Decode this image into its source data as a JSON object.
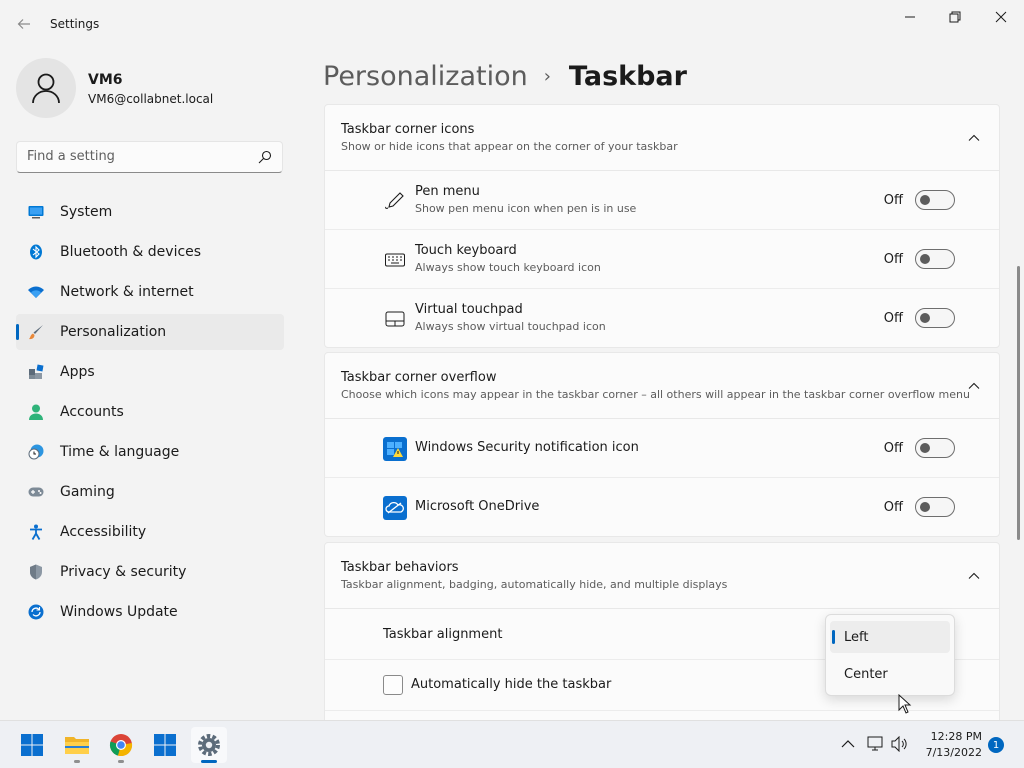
{
  "window": {
    "title": "Settings"
  },
  "profile": {
    "name": "VM6",
    "email": "VM6@collabnet.local"
  },
  "search": {
    "placeholder": "Find a setting"
  },
  "sidebar": {
    "items": [
      {
        "label": "System",
        "icon": "monitor-icon"
      },
      {
        "label": "Bluetooth & devices",
        "icon": "bluetooth-icon"
      },
      {
        "label": "Network & internet",
        "icon": "wifi-icon"
      },
      {
        "label": "Personalization",
        "icon": "paintbrush-icon",
        "active": true
      },
      {
        "label": "Apps",
        "icon": "apps-icon"
      },
      {
        "label": "Accounts",
        "icon": "person-icon"
      },
      {
        "label": "Time & language",
        "icon": "globe-clock-icon"
      },
      {
        "label": "Gaming",
        "icon": "gamepad-icon"
      },
      {
        "label": "Accessibility",
        "icon": "accessibility-icon"
      },
      {
        "label": "Privacy & security",
        "icon": "shield-icon"
      },
      {
        "label": "Windows Update",
        "icon": "update-icon"
      }
    ]
  },
  "breadcrumb": {
    "parent": "Personalization",
    "separator": "›",
    "current": "Taskbar"
  },
  "sections": {
    "corner_icons": {
      "title": "Taskbar corner icons",
      "subtitle": "Show or hide icons that appear on the corner of your taskbar",
      "items": [
        {
          "title": "Pen menu",
          "subtitle": "Show pen menu icon when pen is in use",
          "state": "Off",
          "icon": "pen-icon"
        },
        {
          "title": "Touch keyboard",
          "subtitle": "Always show touch keyboard icon",
          "state": "Off",
          "icon": "keyboard-icon"
        },
        {
          "title": "Virtual touchpad",
          "subtitle": "Always show virtual touchpad icon",
          "state": "Off",
          "icon": "touchpad-icon"
        }
      ]
    },
    "corner_overflow": {
      "title": "Taskbar corner overflow",
      "subtitle": "Choose which icons may appear in the taskbar corner – all others will appear in the taskbar corner overflow menu",
      "items": [
        {
          "title": "Windows Security notification icon",
          "state": "Off",
          "icon": "windows-security-icon"
        },
        {
          "title": "Microsoft OneDrive",
          "state": "Off",
          "icon": "onedrive-icon"
        }
      ]
    },
    "behaviors": {
      "title": "Taskbar behaviors",
      "subtitle": "Taskbar alignment, badging, automatically hide, and multiple displays",
      "alignment_label": "Taskbar alignment",
      "autohide_label": "Automatically hide the taskbar"
    }
  },
  "alignment_dropdown": {
    "options": [
      "Left",
      "Center"
    ],
    "selected": "Left"
  },
  "taskbar": {
    "apps": [
      "start-icon",
      "file-explorer-icon",
      "chrome-icon",
      "store-icon",
      "settings-icon"
    ],
    "time": "12:28 PM",
    "date": "7/13/2022",
    "notification_count": "1"
  },
  "colors": {
    "accent": "#0067c0",
    "background": "#f3f3f3",
    "card": "#fbfbfb"
  }
}
